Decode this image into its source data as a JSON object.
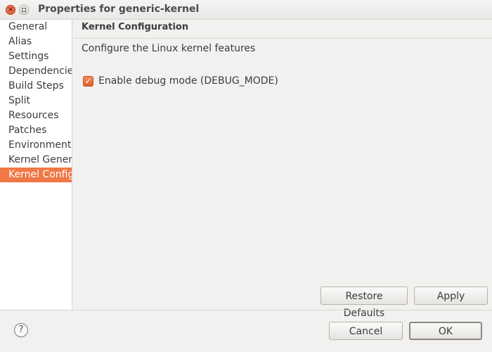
{
  "window": {
    "title": "Properties for generic-kernel",
    "controls": {
      "close_icon": "close-icon",
      "maximize_icon": "maximize-icon"
    }
  },
  "sidebar": {
    "items": [
      {
        "label": "General",
        "selected": false
      },
      {
        "label": "Alias",
        "selected": false
      },
      {
        "label": "Settings",
        "selected": false
      },
      {
        "label": "Dependencies",
        "selected": false
      },
      {
        "label": "Build Steps",
        "selected": false
      },
      {
        "label": "Split",
        "selected": false
      },
      {
        "label": "Resources",
        "selected": false
      },
      {
        "label": "Patches",
        "selected": false
      },
      {
        "label": "Environment",
        "selected": false
      },
      {
        "label": "Kernel Generator",
        "selected": false
      },
      {
        "label": "Kernel Configuration",
        "selected": true
      }
    ]
  },
  "page": {
    "title": "Kernel Configuration",
    "description": "Configure the Linux kernel features",
    "debug_checkbox": {
      "label": "Enable debug mode (DEBUG_MODE)",
      "checked": true
    }
  },
  "page_buttons": {
    "restore_defaults": "Restore Defaults",
    "apply": "Apply"
  },
  "dialog_buttons": {
    "cancel": "Cancel",
    "ok": "OK"
  },
  "help": {
    "icon": "help-icon",
    "glyph": "?"
  },
  "colors": {
    "accent": "#f07746",
    "window_bg": "#f2f1f0",
    "sidebar_bg": "#ffffff"
  }
}
